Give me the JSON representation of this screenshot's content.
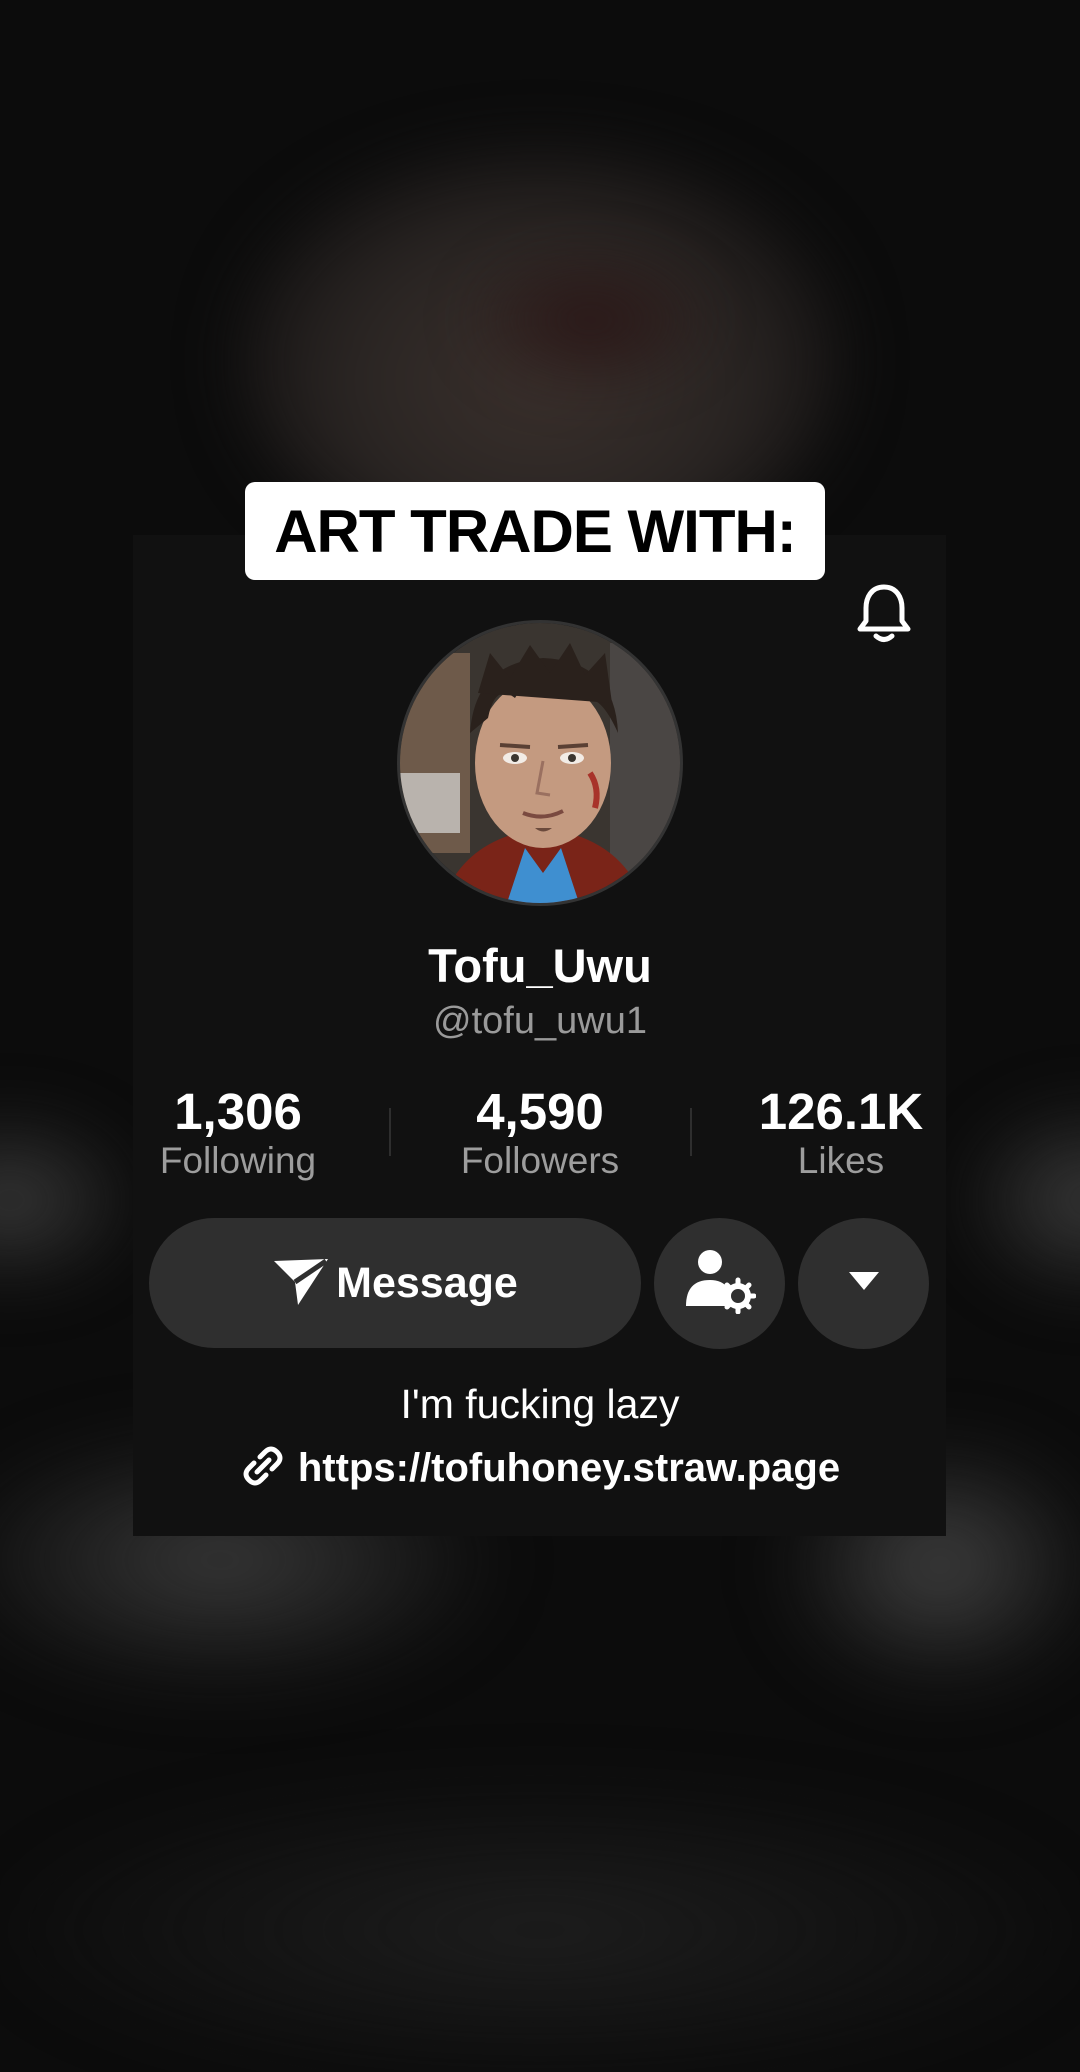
{
  "overlay": {
    "caption": "ART TRADE WITH:"
  },
  "profile": {
    "display_name": "Tofu_Uwu",
    "handle": "@tofu_uwu1",
    "bio": "I'm fucking lazy",
    "link": "https://tofuhoney.straw.page"
  },
  "stats": [
    {
      "value": "1,306",
      "label": "Following"
    },
    {
      "value": "4,590",
      "label": "Followers"
    },
    {
      "value": "126.1K",
      "label": "Likes"
    }
  ],
  "actions": {
    "message_label": "Message"
  },
  "icons": {
    "notification": "bell-icon",
    "message": "send-icon",
    "friends": "user-settings-icon",
    "more": "caret-down-icon",
    "link": "link-icon"
  },
  "colors": {
    "card_bg": "#111111",
    "button_bg": "#2f2f2f",
    "secondary_text": "#9d9d9d",
    "caption_bg": "#ffffff"
  }
}
